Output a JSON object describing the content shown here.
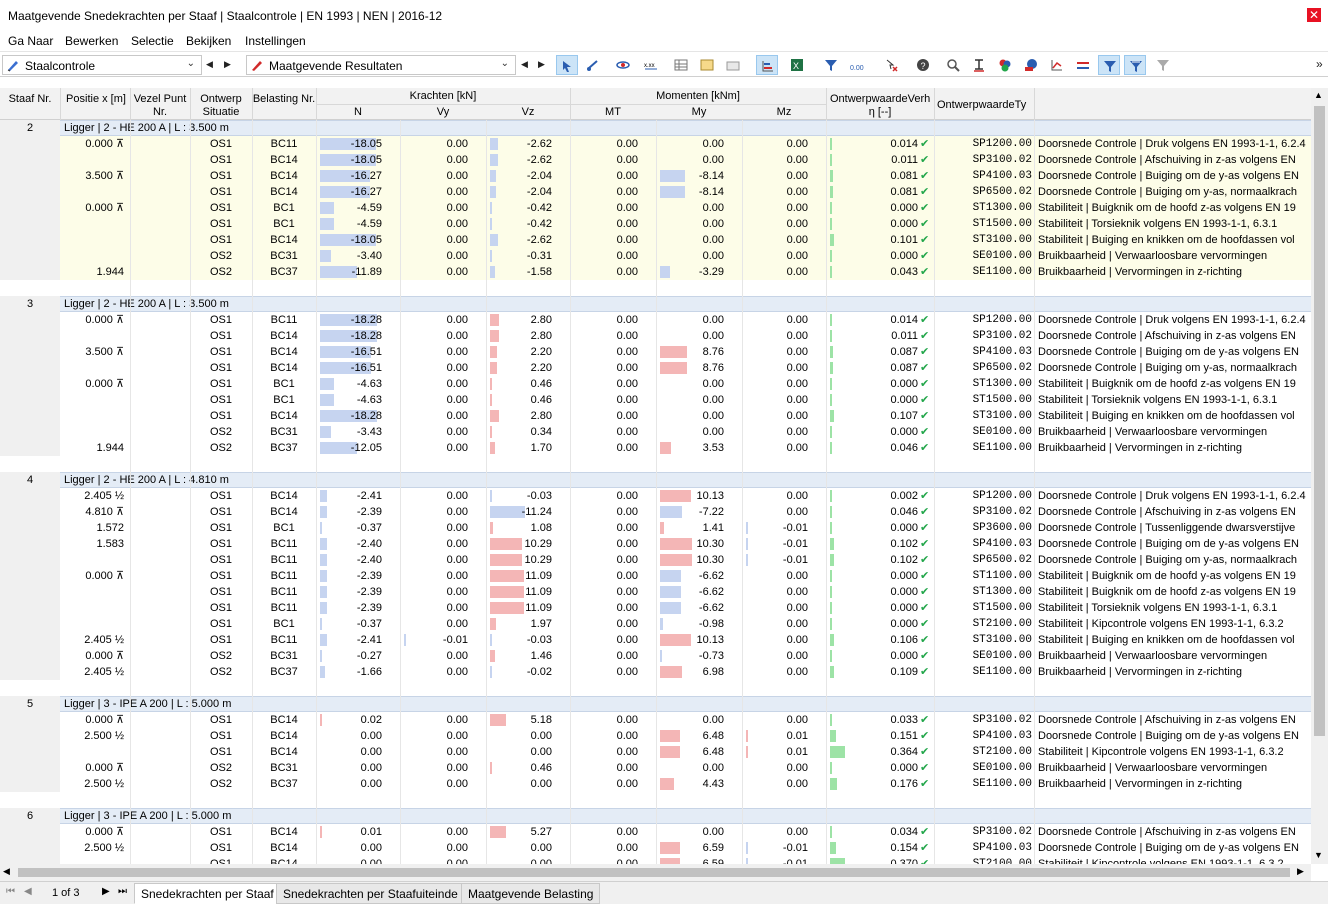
{
  "window": {
    "title": "Maatgevende Snedekrachten per Staaf | Staalcontrole | EN 1993 | NEN | 2016-12",
    "close": "✕"
  },
  "menu": [
    "Ga Naar",
    "Bewerken",
    "Selectie",
    "Bekijken",
    "Instellingen"
  ],
  "toolbar": {
    "module": "Staalcontrole",
    "result": "Maatgevende Resultaten",
    "more": "»",
    "nav_prev": "◀",
    "nav_next": "▶"
  },
  "header": {
    "staaf": "Staaf Nr.",
    "positie": "Positie x [m]",
    "vezel": "Vezel Punt Nr.",
    "ontwerp": "Ontwerp Situatie",
    "belasting": "Belasting Nr.",
    "krachten": "Krachten [kN]",
    "momenten": "Momenten [kNm]",
    "n": "N",
    "vy": "Vy",
    "vz": "Vz",
    "mt": "MT",
    "my": "My",
    "mz": "Mz",
    "ontw_verh": "OntwerpwaardeVerh",
    "eta": "η [--]",
    "ontw_type": "OntwerpwaardeTy"
  },
  "colors": {
    "blue_bar": "#c6d4f0",
    "red_bar": "#f4b6b6",
    "green_bar": "#9de3a6",
    "check": "#22a64a",
    "group_bg": "#e4ecf6",
    "yellow_bg": "#fdfde8"
  },
  "groups": [
    {
      "staaf": "2",
      "label": "Ligger | 2 - HE 200 A | L : 3.500 m",
      "yellow": true,
      "rows": [
        [
          "0.000 ⊼",
          "OS1",
          "BC11",
          "-18.05",
          "0.00",
          "-2.62",
          "0.00",
          "0.00",
          "0.00",
          "0.014",
          "SP1200.00",
          "Doorsnede Controle | Druk volgens EN 1993-1-1, 6.2.4"
        ],
        [
          "",
          "OS1",
          "BC14",
          "-18.05",
          "0.00",
          "-2.62",
          "0.00",
          "0.00",
          "0.00",
          "0.011",
          "SP3100.02",
          "Doorsnede Controle | Afschuiving in z-as volgens EN"
        ],
        [
          "3.500 ⊼",
          "OS1",
          "BC14",
          "-16.27",
          "0.00",
          "-2.04",
          "0.00",
          "-8.14",
          "0.00",
          "0.081",
          "SP4100.03",
          "Doorsnede Controle | Buiging om de y-as volgens EN"
        ],
        [
          "",
          "OS1",
          "BC14",
          "-16.27",
          "0.00",
          "-2.04",
          "0.00",
          "-8.14",
          "0.00",
          "0.081",
          "SP6500.02",
          "Doorsnede Controle | Buiging om y-as, normaalkrach"
        ],
        [
          "0.000 ⊼",
          "OS1",
          "BC1",
          "-4.59",
          "0.00",
          "-0.42",
          "0.00",
          "0.00",
          "0.00",
          "0.000",
          "ST1300.00",
          "Stabiliteit | Buigknik om de hoofd z-as volgens EN 19"
        ],
        [
          "",
          "OS1",
          "BC1",
          "-4.59",
          "0.00",
          "-0.42",
          "0.00",
          "0.00",
          "0.00",
          "0.000",
          "ST1500.00",
          "Stabiliteit | Torsieknik volgens EN 1993-1-1, 6.3.1"
        ],
        [
          "",
          "OS1",
          "BC14",
          "-18.05",
          "0.00",
          "-2.62",
          "0.00",
          "0.00",
          "0.00",
          "0.101",
          "ST3100.00",
          "Stabiliteit | Buiging en knikken om de hoofdassen vol"
        ],
        [
          "",
          "OS2",
          "BC31",
          "-3.40",
          "0.00",
          "-0.31",
          "0.00",
          "0.00",
          "0.00",
          "0.000",
          "SE0100.00",
          "Bruikbaarheid | Verwaarloosbare vervormingen"
        ],
        [
          "1.944",
          "OS2",
          "BC37",
          "-11.89",
          "0.00",
          "-1.58",
          "0.00",
          "-3.29",
          "0.00",
          "0.043",
          "SE1100.00",
          "Bruikbaarheid | Vervormingen in z-richting"
        ]
      ]
    },
    {
      "staaf": "3",
      "label": "Ligger | 2 - HE 200 A | L : 3.500 m",
      "yellow": false,
      "rows": [
        [
          "0.000 ⊼",
          "OS1",
          "BC11",
          "-18.28",
          "0.00",
          "2.80",
          "0.00",
          "0.00",
          "0.00",
          "0.014",
          "SP1200.00",
          "Doorsnede Controle | Druk volgens EN 1993-1-1, 6.2.4"
        ],
        [
          "",
          "OS1",
          "BC14",
          "-18.28",
          "0.00",
          "2.80",
          "0.00",
          "0.00",
          "0.00",
          "0.011",
          "SP3100.02",
          "Doorsnede Controle | Afschuiving in z-as volgens EN"
        ],
        [
          "3.500 ⊼",
          "OS1",
          "BC14",
          "-16.51",
          "0.00",
          "2.20",
          "0.00",
          "8.76",
          "0.00",
          "0.087",
          "SP4100.03",
          "Doorsnede Controle | Buiging om de y-as volgens EN"
        ],
        [
          "",
          "OS1",
          "BC14",
          "-16.51",
          "0.00",
          "2.20",
          "0.00",
          "8.76",
          "0.00",
          "0.087",
          "SP6500.02",
          "Doorsnede Controle | Buiging om y-as, normaalkrach"
        ],
        [
          "0.000 ⊼",
          "OS1",
          "BC1",
          "-4.63",
          "0.00",
          "0.46",
          "0.00",
          "0.00",
          "0.00",
          "0.000",
          "ST1300.00",
          "Stabiliteit | Buigknik om de hoofd z-as volgens EN 19"
        ],
        [
          "",
          "OS1",
          "BC1",
          "-4.63",
          "0.00",
          "0.46",
          "0.00",
          "0.00",
          "0.00",
          "0.000",
          "ST1500.00",
          "Stabiliteit | Torsieknik volgens EN 1993-1-1, 6.3.1"
        ],
        [
          "",
          "OS1",
          "BC14",
          "-18.28",
          "0.00",
          "2.80",
          "0.00",
          "0.00",
          "0.00",
          "0.107",
          "ST3100.00",
          "Stabiliteit | Buiging en knikken om de hoofdassen vol"
        ],
        [
          "",
          "OS2",
          "BC31",
          "-3.43",
          "0.00",
          "0.34",
          "0.00",
          "0.00",
          "0.00",
          "0.000",
          "SE0100.00",
          "Bruikbaarheid | Verwaarloosbare vervormingen"
        ],
        [
          "1.944",
          "OS2",
          "BC37",
          "-12.05",
          "0.00",
          "1.70",
          "0.00",
          "3.53",
          "0.00",
          "0.046",
          "SE1100.00",
          "Bruikbaarheid | Vervormingen in z-richting"
        ]
      ]
    },
    {
      "staaf": "4",
      "label": "Ligger | 2 - HE 200 A | L : 4.810 m",
      "yellow": false,
      "rows": [
        [
          "2.405 ½",
          "OS1",
          "BC14",
          "-2.41",
          "0.00",
          "-0.03",
          "0.00",
          "10.13",
          "0.00",
          "0.002",
          "SP1200.00",
          "Doorsnede Controle | Druk volgens EN 1993-1-1, 6.2.4"
        ],
        [
          "4.810 ⊼",
          "OS1",
          "BC14",
          "-2.39",
          "0.00",
          "-11.24",
          "0.00",
          "-7.22",
          "0.00",
          "0.046",
          "SP3100.02",
          "Doorsnede Controle | Afschuiving in z-as volgens EN"
        ],
        [
          "1.572",
          "OS1",
          "BC1",
          "-0.37",
          "0.00",
          "1.08",
          "0.00",
          "1.41",
          "-0.01",
          "0.000",
          "SP3600.00",
          "Doorsnede Controle | Tussenliggende dwarsverstijve"
        ],
        [
          "1.583",
          "OS1",
          "BC11",
          "-2.40",
          "0.00",
          "10.29",
          "0.00",
          "10.30",
          "-0.01",
          "0.102",
          "SP4100.03",
          "Doorsnede Controle | Buiging om de y-as volgens EN"
        ],
        [
          "",
          "OS1",
          "BC11",
          "-2.40",
          "0.00",
          "10.29",
          "0.00",
          "10.30",
          "-0.01",
          "0.102",
          "SP6500.02",
          "Doorsnede Controle | Buiging om y-as, normaalkrach"
        ],
        [
          "0.000 ⊼",
          "OS1",
          "BC11",
          "-2.39",
          "0.00",
          "11.09",
          "0.00",
          "-6.62",
          "0.00",
          "0.000",
          "ST1100.00",
          "Stabiliteit | Buigknik om de hoofd y-as volgens EN 19"
        ],
        [
          "",
          "OS1",
          "BC11",
          "-2.39",
          "0.00",
          "11.09",
          "0.00",
          "-6.62",
          "0.00",
          "0.000",
          "ST1300.00",
          "Stabiliteit | Buigknik om de hoofd z-as volgens EN 19"
        ],
        [
          "",
          "OS1",
          "BC11",
          "-2.39",
          "0.00",
          "11.09",
          "0.00",
          "-6.62",
          "0.00",
          "0.000",
          "ST1500.00",
          "Stabiliteit | Torsieknik volgens EN 1993-1-1, 6.3.1"
        ],
        [
          "",
          "OS1",
          "BC1",
          "-0.37",
          "0.00",
          "1.97",
          "0.00",
          "-0.98",
          "0.00",
          "0.000",
          "ST2100.00",
          "Stabiliteit | Kipcontrole volgens EN 1993-1-1, 6.3.2"
        ],
        [
          "2.405 ½",
          "OS1",
          "BC11",
          "-2.41",
          "-0.01",
          "-0.03",
          "0.00",
          "10.13",
          "0.00",
          "0.106",
          "ST3100.00",
          "Stabiliteit | Buiging en knikken om de hoofdassen vol"
        ],
        [
          "0.000 ⊼",
          "OS2",
          "BC31",
          "-0.27",
          "0.00",
          "1.46",
          "0.00",
          "-0.73",
          "0.00",
          "0.000",
          "SE0100.00",
          "Bruikbaarheid | Verwaarloosbare vervormingen"
        ],
        [
          "2.405 ½",
          "OS2",
          "BC37",
          "-1.66",
          "0.00",
          "-0.02",
          "0.00",
          "6.98",
          "0.00",
          "0.109",
          "SE1100.00",
          "Bruikbaarheid | Vervormingen in z-richting"
        ]
      ]
    },
    {
      "staaf": "5",
      "label": "Ligger | 3 - IPE A 200 | L : 5.000 m",
      "yellow": false,
      "rows": [
        [
          "0.000 ⊼",
          "OS1",
          "BC14",
          "0.02",
          "0.00",
          "5.18",
          "0.00",
          "0.00",
          "0.00",
          "0.033",
          "SP3100.02",
          "Doorsnede Controle | Afschuiving in z-as volgens EN"
        ],
        [
          "2.500 ½",
          "OS1",
          "BC14",
          "0.00",
          "0.00",
          "0.00",
          "0.00",
          "6.48",
          "0.01",
          "0.151",
          "SP4100.03",
          "Doorsnede Controle | Buiging om de y-as volgens EN"
        ],
        [
          "",
          "OS1",
          "BC14",
          "0.00",
          "0.00",
          "0.00",
          "0.00",
          "6.48",
          "0.01",
          "0.364",
          "ST2100.00",
          "Stabiliteit | Kipcontrole volgens EN 1993-1-1, 6.3.2"
        ],
        [
          "0.000 ⊼",
          "OS2",
          "BC31",
          "0.00",
          "0.00",
          "0.46",
          "0.00",
          "0.00",
          "0.00",
          "0.000",
          "SE0100.00",
          "Bruikbaarheid | Verwaarloosbare vervormingen"
        ],
        [
          "2.500 ½",
          "OS2",
          "BC37",
          "0.00",
          "0.00",
          "0.00",
          "0.00",
          "4.43",
          "0.00",
          "0.176",
          "SE1100.00",
          "Bruikbaarheid | Vervormingen in z-richting"
        ]
      ]
    },
    {
      "staaf": "6",
      "label": "Ligger | 3 - IPE A 200 | L : 5.000 m",
      "yellow": false,
      "rows": [
        [
          "0.000 ⊼",
          "OS1",
          "BC14",
          "0.01",
          "0.00",
          "5.27",
          "0.00",
          "0.00",
          "0.00",
          "0.034",
          "SP3100.02",
          "Doorsnede Controle | Afschuiving in z-as volgens EN"
        ],
        [
          "2.500 ½",
          "OS1",
          "BC14",
          "0.00",
          "0.00",
          "0.00",
          "0.00",
          "6.59",
          "-0.01",
          "0.154",
          "SP4100.03",
          "Doorsnede Controle | Buiging om de y-as volgens EN"
        ],
        [
          "",
          "OS1",
          "BC14",
          "0.00",
          "0.00",
          "0.00",
          "0.00",
          "6.59",
          "-0.01",
          "0.370",
          "ST2100.00",
          "Stabiliteit | Kipcontrole volgens EN 1993-1-1, 6.3.2"
        ]
      ]
    }
  ],
  "status": {
    "page": "1 of 3",
    "tabs": [
      "Snedekrachten per Staaf",
      "Snedekrachten per Staafuiteinde",
      "Maatgevende Belasting"
    ]
  }
}
